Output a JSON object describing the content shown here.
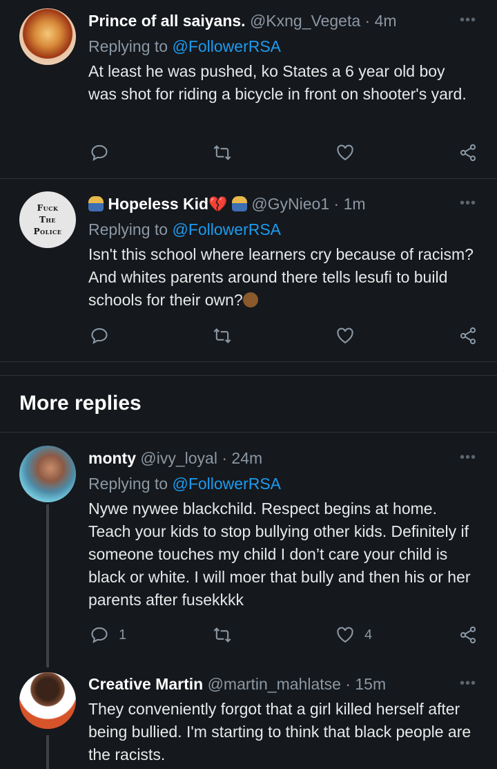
{
  "tweets": [
    {
      "name": "Prince of all saiyans.",
      "handle": "@Kxng_Vegeta",
      "sep": "·",
      "time": "4m",
      "replying_prefix": "Replying to",
      "replying_to": "@FollowerRSA",
      "text": "At least he was pushed, ko States a 6 year old boy was shot for riding a bicycle in front on shooter's yard.",
      "more": "•••",
      "reply_count": "",
      "like_count": ""
    },
    {
      "name_prefix_emoji": "person-shrugging-emoji",
      "name": "Hopeless Kid",
      "name_suffix_emoji": "broken-heart-emoji",
      "handle": "@GyNieo1",
      "sep": "·",
      "time": "1m",
      "replying_prefix": "Replying to",
      "replying_to": "@FollowerRSA",
      "text": "Isn't this school where learners cry because of racism? And whites parents around there tells lesufi to build schools for their own?",
      "more": "•••",
      "avatar_text": [
        "Fuck",
        "The",
        "Police"
      ]
    },
    {
      "name": "monty",
      "handle": "@ivy_loyal",
      "sep": "·",
      "time": "24m",
      "replying_prefix": "Replying to",
      "replying_to": "@FollowerRSA",
      "text": "Nywe nywee blackchild. Respect begins at home. Teach your kids to stop bullying other kids. Definitely if someone touches my child I don’t care your child is black or white. I will moer that bully and then his or her parents after fusekkkk",
      "more": "•••",
      "reply_count": "1",
      "like_count": "4"
    },
    {
      "name": "Creative Martin",
      "handle": "@martin_mahlatse",
      "sep": "·",
      "time": "15m",
      "text": "They conveniently forgot that a girl killed herself after being bullied. I'm starting to think that black people are the racists.",
      "more": "•••"
    }
  ],
  "section": {
    "more_replies": "More replies"
  },
  "colors": {
    "background": "#15181c",
    "accent": "#1d9bf0",
    "muted": "#8b98a5",
    "separator": "#2f3336"
  }
}
